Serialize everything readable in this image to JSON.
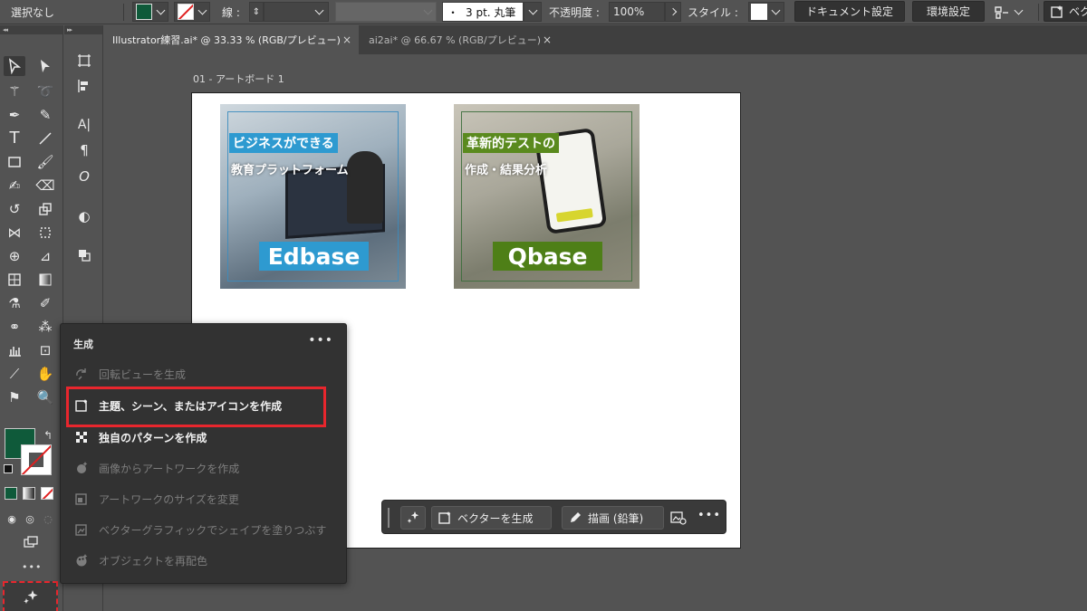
{
  "topbar": {
    "selection_label": "選択なし",
    "stroke_label": "線 :",
    "brush_value": "3 pt. 丸筆",
    "brush_dot": "・",
    "opacity_label": "不透明度 :",
    "opacity_value": "100%",
    "style_label": "スタイル :",
    "doc_settings_button": "ドキュメント設定",
    "preferences_button": "環境設定",
    "vector_button": "ベク",
    "fill_color": "#0f5a3a"
  },
  "tabs": [
    {
      "label": "Illustrator練習.ai* @ 33.33 % (RGB/プレビュー)",
      "close": "×"
    },
    {
      "label": "ai2ai* @ 66.67 % (RGB/プレビュー)",
      "close": "×"
    }
  ],
  "toolbar_header_left": "◂◂",
  "panel_header": "▸▸",
  "toolbar_more": "•••",
  "artboard": {
    "label": "01 - アートボード 1"
  },
  "cards": [
    {
      "tag1": "ビジネスができる",
      "tag2": "教育プラットフォーム",
      "brand": "Edbase",
      "accent": "#2e9ad0"
    },
    {
      "tag1": "革新的テストの",
      "tag2": "作成・結果分析",
      "brand": "Qbase",
      "accent": "#4e7f17"
    }
  ],
  "taskbar": {
    "generate_vector_label": "ベクターを生成",
    "draw_label": "描画 (鉛筆)",
    "more": "•••"
  },
  "flyout": {
    "title": "生成",
    "more": "•••",
    "items": [
      {
        "label": "回転ビューを生成",
        "enabled": false
      },
      {
        "label": "主題、シーン、またはアイコンを作成",
        "enabled": true
      },
      {
        "label": "独自のパターンを作成",
        "enabled": true
      },
      {
        "label": "画像からアートワークを作成",
        "enabled": false
      },
      {
        "label": "アートワークのサイズを変更",
        "enabled": false
      },
      {
        "label": "ベクターグラフィックでシェイプを塗りつぶす",
        "enabled": false
      },
      {
        "label": "オブジェクトを再配色",
        "enabled": false
      }
    ]
  },
  "colors": {
    "highlight": "#e8262d",
    "fill": "#0f5a3a",
    "stroke_none": "#e02020"
  }
}
